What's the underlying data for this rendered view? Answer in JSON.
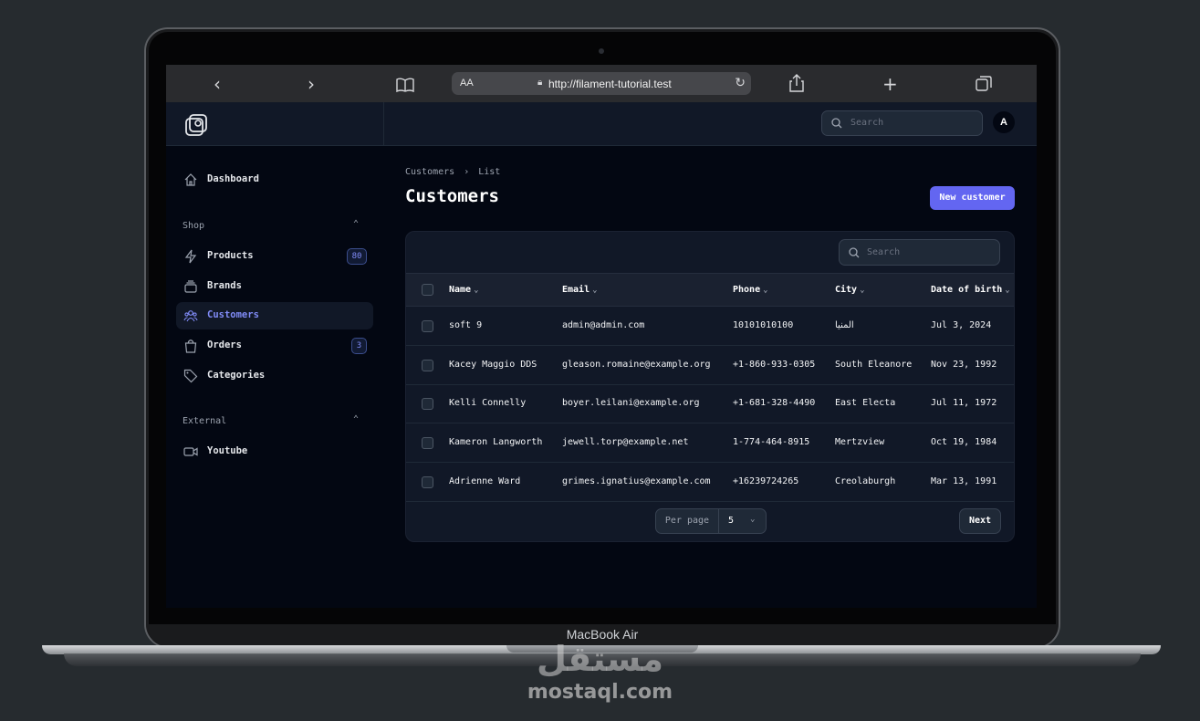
{
  "browser": {
    "url": "http://filament-tutorial.test",
    "text_size_label": "AA"
  },
  "device": {
    "model": "MacBook Air"
  },
  "watermark": {
    "arabic": "مستقل",
    "site": "mostaql.com"
  },
  "topbar": {
    "search_placeholder": "Search",
    "avatar_initial": "A"
  },
  "sidebar": {
    "dashboard": "Dashboard",
    "group_shop": "Shop",
    "products": "Products",
    "products_count": "80",
    "brands": "Brands",
    "customers": "Customers",
    "orders": "Orders",
    "orders_count": "3",
    "categories": "Categories",
    "group_external": "External",
    "youtube": "Youtube"
  },
  "page": {
    "breadcrumb_parent": "Customers",
    "breadcrumb_current": "List",
    "title": "Customers",
    "new_button": "New customer",
    "search_placeholder": "Search"
  },
  "table": {
    "columns": [
      "Name",
      "Email",
      "Phone",
      "City",
      "Date of birth"
    ],
    "rows": [
      [
        "soft 9",
        "admin@admin.com",
        "10101010100",
        "المنيا",
        "Jul 3, 2024"
      ],
      [
        "Kacey Maggio DDS",
        "gleason.romaine@example.org",
        "+1-860-933-0305",
        "South Eleanore",
        "Nov 23, 1992"
      ],
      [
        "Kelli Connelly",
        "boyer.leilani@example.org",
        "+1-681-328-4490",
        "East Electa",
        "Jul 11, 1972"
      ],
      [
        "Kameron Langworth",
        "jewell.torp@example.net",
        "1-774-464-8915",
        "Mertzview",
        "Oct 19, 1984"
      ],
      [
        "Adrienne Ward",
        "grimes.ignatius@example.com",
        "+16239724265",
        "Creolaburgh",
        "Mar 13, 1991"
      ]
    ]
  },
  "pagination": {
    "per_page_label": "Per page",
    "per_page_value": "5",
    "next_label": "Next"
  },
  "colors": {
    "accent": "#6366f1",
    "active_nav": "#818cf8",
    "background": "#030712",
    "panel": "#111827"
  }
}
